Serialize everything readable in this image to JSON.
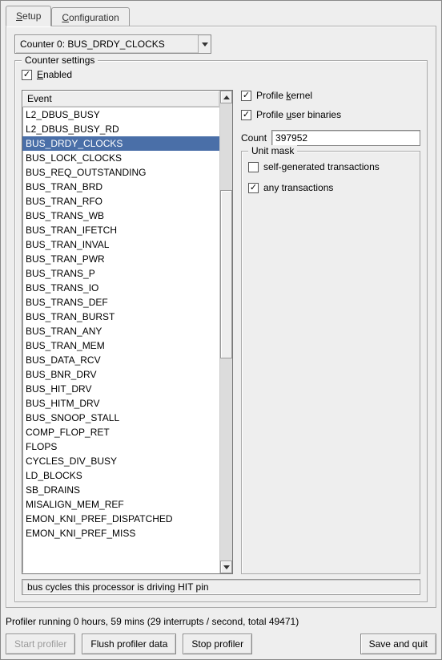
{
  "tabs": {
    "setup": "Setup",
    "config": "Configuration"
  },
  "dropdown": {
    "label": "Counter 0: BUS_DRDY_CLOCKS"
  },
  "counter_settings": {
    "legend": "Counter settings",
    "enabled_label": "Enabled",
    "enabled": true,
    "event_header": "Event",
    "selected_event": "BUS_DRDY_CLOCKS",
    "events": [
      "L2_DBUS_BUSY",
      "L2_DBUS_BUSY_RD",
      "BUS_DRDY_CLOCKS",
      "BUS_LOCK_CLOCKS",
      "BUS_REQ_OUTSTANDING",
      "BUS_TRAN_BRD",
      "BUS_TRAN_RFO",
      "BUS_TRANS_WB",
      "BUS_TRAN_IFETCH",
      "BUS_TRAN_INVAL",
      "BUS_TRAN_PWR",
      "BUS_TRANS_P",
      "BUS_TRANS_IO",
      "BUS_TRANS_DEF",
      "BUS_TRAN_BURST",
      "BUS_TRAN_ANY",
      "BUS_TRAN_MEM",
      "BUS_DATA_RCV",
      "BUS_BNR_DRV",
      "BUS_HIT_DRV",
      "BUS_HITM_DRV",
      "BUS_SNOOP_STALL",
      "COMP_FLOP_RET",
      "FLOPS",
      "CYCLES_DIV_BUSY",
      "LD_BLOCKS",
      "SB_DRAINS",
      "MISALIGN_MEM_REF",
      "EMON_KNI_PREF_DISPATCHED",
      "EMON_KNI_PREF_MISS"
    ],
    "description": "bus cycles this processor is driving HIT pin"
  },
  "right": {
    "profile_kernel": {
      "label": "Profile kernel",
      "checked": true
    },
    "profile_user": {
      "label": "Profile user binaries",
      "checked": true
    },
    "count_label": "Count",
    "count_value": "397952",
    "unit_mask_legend": "Unit mask",
    "unit_mask": {
      "self_gen": {
        "label": "self-generated transactions",
        "checked": false
      },
      "any": {
        "label": "any transactions",
        "checked": true
      }
    }
  },
  "status": "Profiler running 0 hours, 59 mins (29 interrupts / second, total 49471)",
  "buttons": {
    "start": "Start profiler",
    "flush": "Flush profiler data",
    "stop": "Stop profiler",
    "save": "Save and quit"
  }
}
